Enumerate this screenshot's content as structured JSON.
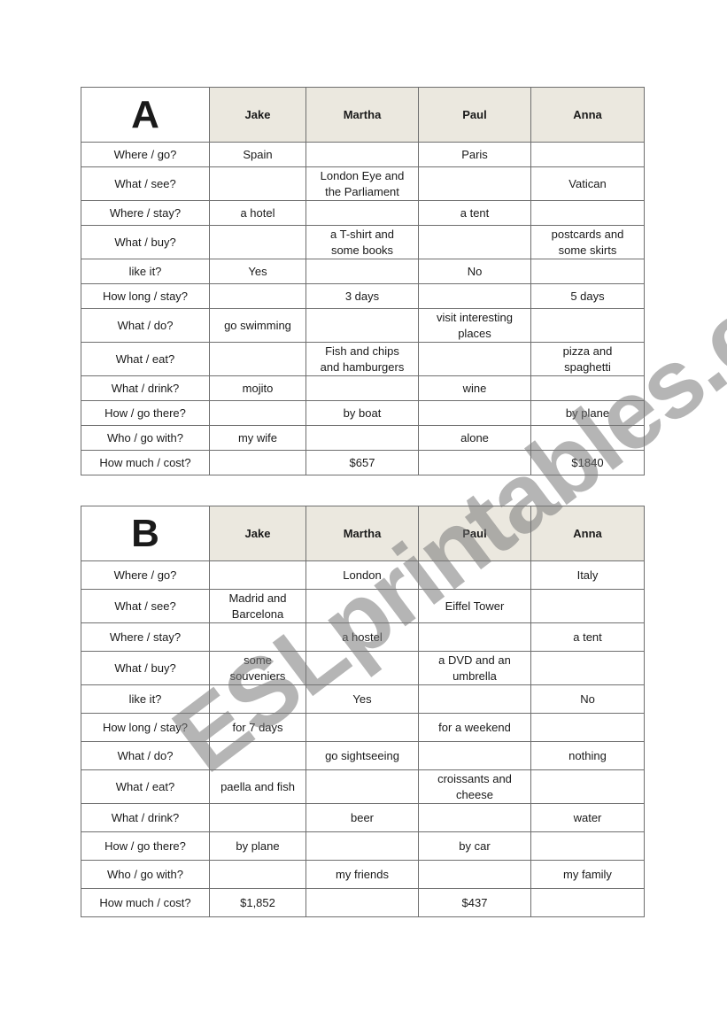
{
  "watermark": "ESLprintables.com",
  "columns": [
    "Jake",
    "Martha",
    "Paul",
    "Anna"
  ],
  "tables": [
    {
      "letter": "A",
      "rows": [
        {
          "q": "Where / go?",
          "cells": [
            "Spain",
            "",
            "Paris",
            ""
          ]
        },
        {
          "q": "What / see?",
          "cells": [
            "",
            "London Eye and the Parliament",
            "",
            "Vatican"
          ]
        },
        {
          "q": "Where / stay?",
          "cells": [
            "a hotel",
            "",
            "a tent",
            ""
          ]
        },
        {
          "q": "What / buy?",
          "cells": [
            "",
            "a T-shirt and some books",
            "",
            "postcards and some skirts"
          ]
        },
        {
          "q": "like it?",
          "cells": [
            "Yes",
            "",
            "No",
            ""
          ]
        },
        {
          "q": "How long / stay?",
          "cells": [
            "",
            "3 days",
            "",
            "5 days"
          ]
        },
        {
          "q": "What / do?",
          "cells": [
            "go swimming",
            "",
            "visit interesting places",
            ""
          ]
        },
        {
          "q": "What / eat?",
          "cells": [
            "",
            "Fish and chips and hamburgers",
            "",
            "pizza and spaghetti"
          ]
        },
        {
          "q": "What / drink?",
          "cells": [
            "mojito",
            "",
            "wine",
            ""
          ]
        },
        {
          "q": "How / go there?",
          "cells": [
            "",
            "by boat",
            "",
            "by plane"
          ]
        },
        {
          "q": "Who / go with?",
          "cells": [
            "my wife",
            "",
            "alone",
            ""
          ]
        },
        {
          "q": "How much / cost?",
          "cells": [
            "",
            "$657",
            "",
            "$1840"
          ]
        }
      ]
    },
    {
      "letter": "B",
      "rows": [
        {
          "q": "Where / go?",
          "cells": [
            "",
            "London",
            "",
            "Italy"
          ]
        },
        {
          "q": "What / see?",
          "cells": [
            "Madrid and Barcelona",
            "",
            "Eiffel Tower",
            ""
          ]
        },
        {
          "q": "Where / stay?",
          "cells": [
            "",
            "a hostel",
            "",
            "a tent"
          ]
        },
        {
          "q": "What / buy?",
          "cells": [
            "some souveniers",
            "",
            "a DVD and an umbrella",
            ""
          ]
        },
        {
          "q": "like it?",
          "cells": [
            "",
            "Yes",
            "",
            "No"
          ]
        },
        {
          "q": "How long / stay?",
          "cells": [
            "for 7 days",
            "",
            "for a weekend",
            ""
          ]
        },
        {
          "q": "What / do?",
          "cells": [
            "",
            "go sightseeing",
            "",
            "nothing"
          ]
        },
        {
          "q": "What / eat?",
          "cells": [
            "paella and fish",
            "",
            "croissants and cheese",
            ""
          ]
        },
        {
          "q": "What / drink?",
          "cells": [
            "",
            "beer",
            "",
            "water"
          ]
        },
        {
          "q": "How / go there?",
          "cells": [
            "by plane",
            "",
            "by car",
            ""
          ]
        },
        {
          "q": "Who / go with?",
          "cells": [
            "",
            "my friends",
            "",
            "my family"
          ]
        },
        {
          "q": "How much / cost?",
          "cells": [
            "$1,852",
            "",
            "$437",
            ""
          ]
        }
      ]
    }
  ]
}
